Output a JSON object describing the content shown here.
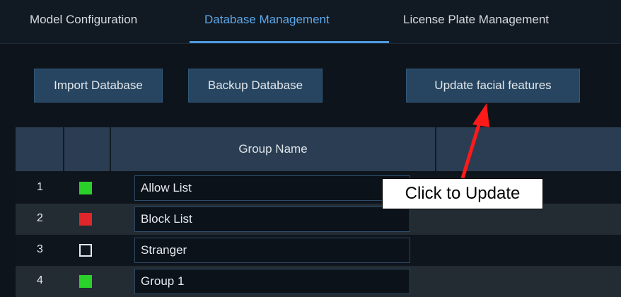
{
  "tabs": [
    {
      "label": "Model Configuration",
      "active": false
    },
    {
      "label": "Database Management",
      "active": true
    },
    {
      "label": "License Plate Management",
      "active": false
    }
  ],
  "buttons": {
    "import": "Import Database",
    "backup": "Backup Database",
    "update": "Update facial features"
  },
  "table": {
    "header": "Group Name",
    "rows": [
      {
        "index": "1",
        "color": "#2bd12b",
        "name": "Allow List"
      },
      {
        "index": "2",
        "color": "#e0262a",
        "name": "Block List"
      },
      {
        "index": "3",
        "color": "none",
        "name": "Stranger"
      },
      {
        "index": "4",
        "color": "#2bd12b",
        "name": "Group 1"
      }
    ]
  },
  "annotation": {
    "text": "Click to Update",
    "arrow_color": "#ff1a1a"
  },
  "colors": {
    "accent": "#4a9be0",
    "button_bg": "#274560"
  }
}
